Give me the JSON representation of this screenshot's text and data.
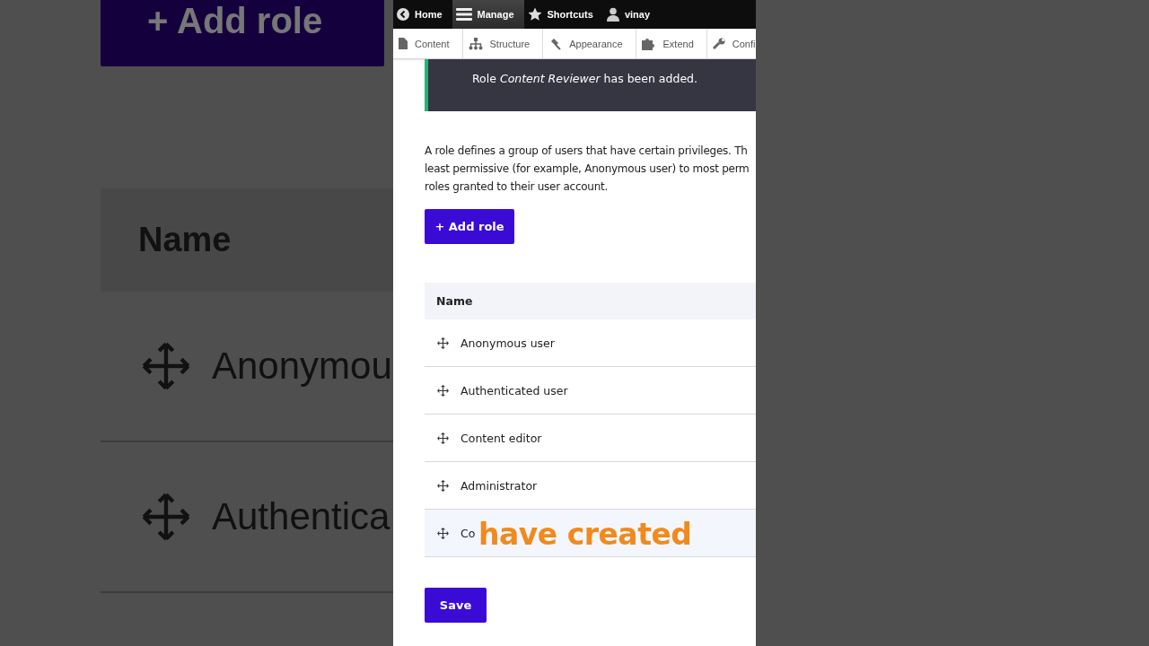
{
  "backdrop": {
    "add_button": "+ Add role",
    "column": "Name",
    "rows": [
      "Anonymou",
      "Authentica"
    ]
  },
  "toolbar": {
    "items": [
      {
        "label": "Home",
        "selected": false
      },
      {
        "label": "Manage",
        "selected": true
      },
      {
        "label": "Shortcuts",
        "selected": false
      },
      {
        "label": "vinay",
        "selected": false
      }
    ]
  },
  "menu": {
    "items": [
      "Content",
      "Structure",
      "Appearance",
      "Extend",
      "Confi"
    ]
  },
  "message": "Role *Content Reviewer* has been added.",
  "description": "A role defines a group of users that have certain privileges. Th\nleast permissive (for example, Anonymous user) to most perm\nroles granted to their user account.",
  "add_button": "+ Add role",
  "table": {
    "columns": [
      "Name"
    ],
    "rows": [
      {
        "name": "Anonymous user",
        "highlighted": false
      },
      {
        "name": "Authenticated user",
        "highlighted": false
      },
      {
        "name": "Content editor",
        "highlighted": false
      },
      {
        "name": "Administrator",
        "highlighted": false
      },
      {
        "name": "Co",
        "highlighted": true
      }
    ]
  },
  "save_button": "Save",
  "caption": "have created"
}
